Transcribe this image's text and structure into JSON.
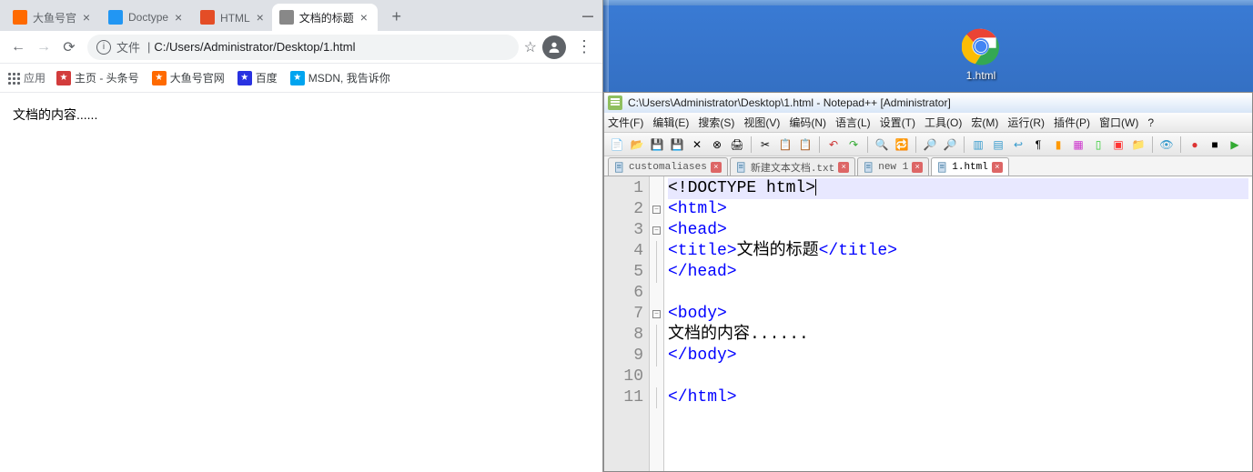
{
  "browser": {
    "tabs": [
      {
        "title": "大鱼号官",
        "favicon_color": "#ff6a00"
      },
      {
        "title": "Doctype",
        "favicon_color": "#2196f3"
      },
      {
        "title": "HTML <!",
        "favicon_color": "#e44d26"
      },
      {
        "title": "文档的标题",
        "favicon_color": "#888",
        "active": true
      }
    ],
    "url_info_label": "i",
    "url_file_label": "文件",
    "url_path": "C:/Users/Administrator/Desktop/1.html",
    "bookmarks": {
      "apps_label": "应用",
      "items": [
        {
          "label": "主页 - 头条号",
          "color": "#d23c3c"
        },
        {
          "label": "大鱼号官网",
          "color": "#ff6a00"
        },
        {
          "label": "百度",
          "color": "#2932e1"
        },
        {
          "label": "MSDN, 我告诉你",
          "color": "#00a4ef"
        }
      ]
    },
    "page_body_text": "文档的内容......"
  },
  "desktop": {
    "shortcut_label": "1.html"
  },
  "notepadpp": {
    "title_text": "C:\\Users\\Administrator\\Desktop\\1.html - Notepad++ [Administrator]",
    "menus": [
      "文件(F)",
      "编辑(E)",
      "搜索(S)",
      "视图(V)",
      "编码(N)",
      "语言(L)",
      "设置(T)",
      "工具(O)",
      "宏(M)",
      "运行(R)",
      "插件(P)",
      "窗口(W)",
      "?"
    ],
    "tabs": [
      {
        "label": "customaliases",
        "active": false
      },
      {
        "label": "新建文本文档.txt",
        "active": false
      },
      {
        "label": "new 1",
        "active": false
      },
      {
        "label": "1.html",
        "active": true
      }
    ],
    "code_lines": [
      {
        "n": 1,
        "html": "<span class='txt'>&lt;!DOCTYPE html&gt;</span><span class='cursor-caret'></span>",
        "hl": true
      },
      {
        "n": 2,
        "html": "<span class='tag'>&lt;html&gt;</span>"
      },
      {
        "n": 3,
        "html": "<span class='tag'>&lt;head&gt;</span>"
      },
      {
        "n": 4,
        "html": "<span class='tag'>&lt;title&gt;</span><span class='txt'>文档的标题</span><span class='tag'>&lt;/title&gt;</span>"
      },
      {
        "n": 5,
        "html": "<span class='tag'>&lt;/head&gt;</span>"
      },
      {
        "n": 6,
        "html": ""
      },
      {
        "n": 7,
        "html": "<span class='tag'>&lt;body&gt;</span>"
      },
      {
        "n": 8,
        "html": "<span class='txt'>文档的内容......</span>"
      },
      {
        "n": 9,
        "html": "<span class='tag'>&lt;/body&gt;</span>"
      },
      {
        "n": 10,
        "html": ""
      },
      {
        "n": 11,
        "html": "<span class='tag'>&lt;/html&gt;</span>"
      }
    ],
    "fold": [
      "",
      "⊟",
      "⊟",
      "│",
      "├",
      "",
      "⊟",
      "│",
      "├",
      "",
      "└"
    ]
  }
}
